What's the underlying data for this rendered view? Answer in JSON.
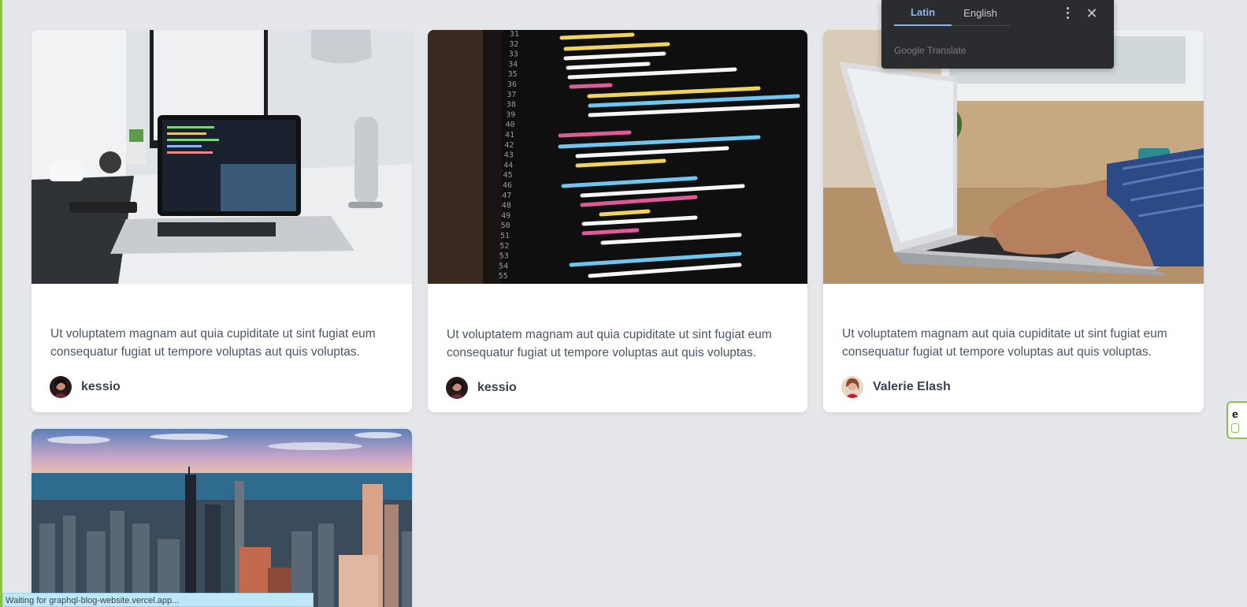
{
  "posts": [
    {
      "excerpt": "Ut voluptatem magnam aut quia cupiditate ut sint fugiat eum consequatur fugiat ut tempore voluptas aut quis voluptas.",
      "author": "kessio"
    },
    {
      "excerpt": "Ut voluptatem magnam aut quia cupiditate ut sint fugiat eum consequatur fugiat ut tempore voluptas aut quis voluptas.",
      "author": "kessio"
    },
    {
      "excerpt": "Ut voluptatem magnam aut quia cupiditate ut sint fugiat eum consequatur fugiat ut tempore voluptas aut quis voluptas.",
      "author": "Valerie Elash"
    }
  ],
  "code_lines": [
    "31",
    "32",
    "33",
    "34",
    "35",
    "36",
    "37",
    "38",
    "39",
    "40",
    "41",
    "42",
    "43",
    "44",
    "45",
    "46",
    "47",
    "48",
    "49",
    "50",
    "51",
    "52",
    "53",
    "54",
    "55"
  ],
  "translate": {
    "tab_source": "Latin",
    "tab_target": "English",
    "brand": "Google Translate",
    "close_glyph": "✕"
  },
  "side_tab_letter": "e",
  "status_text": "Waiting for graphql-blog-website.vercel.app..."
}
